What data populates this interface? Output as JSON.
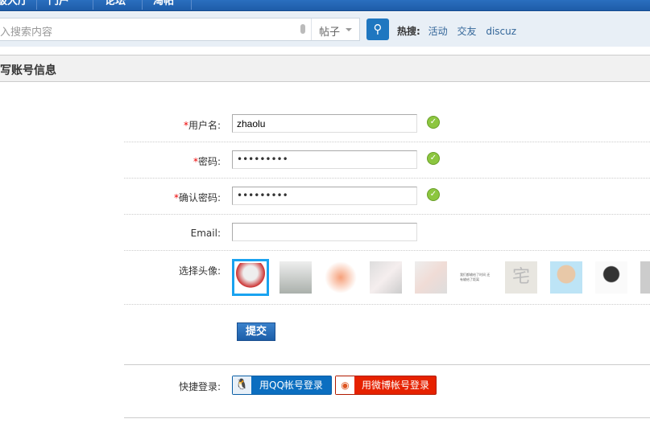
{
  "nav": {
    "items": [
      "级大厅",
      "门户",
      "论坛",
      "淘帖"
    ]
  },
  "search": {
    "placeholder": "输入搜索内容",
    "scope": "帖子",
    "hot_label": "热搜:",
    "hot": [
      "活动",
      "交友",
      "discuz"
    ]
  },
  "page_title": "填写账号信息",
  "form": {
    "username": {
      "label": "用户名:",
      "value": "zhaolu"
    },
    "password": {
      "label": "密码:",
      "value": "•••••••••"
    },
    "confirm": {
      "label": "确认密码:",
      "value": "•••••••••"
    },
    "email": {
      "label": "Email:",
      "value": ""
    },
    "avatar_label": "选择头像:",
    "avatar_text": "我们都输给了时间 还有输给了距离",
    "submit": "提交",
    "quick_label": "快捷登录:",
    "qq": "用QQ帐号登录",
    "weibo": "用微博帐号登录",
    "required": "*"
  },
  "colors": {
    "accent": "#1f77c0",
    "ok": "#8cc63f",
    "selected": "#1aa3f0"
  }
}
